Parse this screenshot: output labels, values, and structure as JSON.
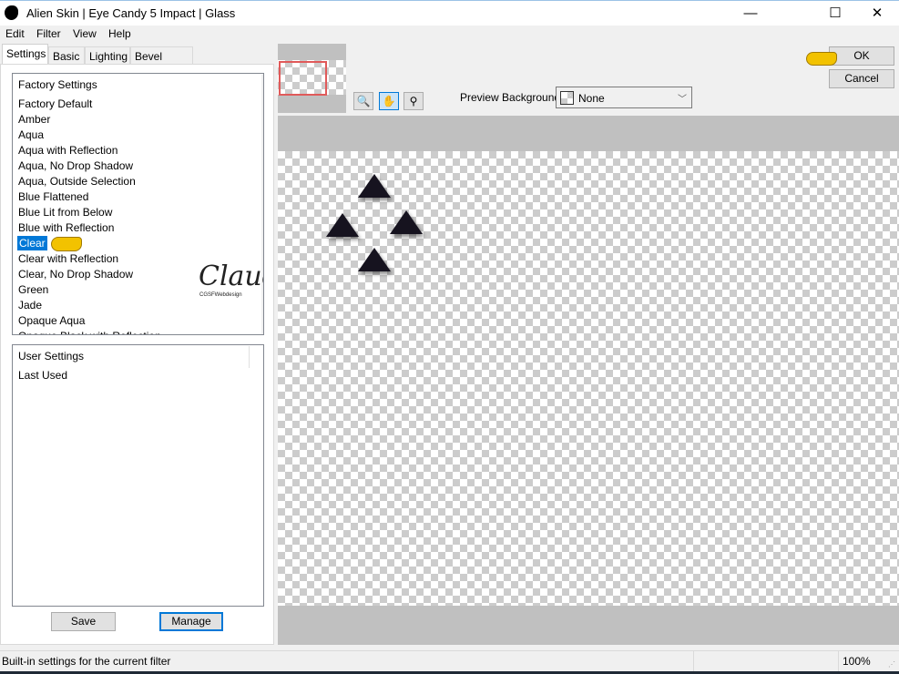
{
  "window": {
    "title": "Alien Skin | Eye Candy 5 Impact | Glass",
    "minimize": "—",
    "maximize": "☐",
    "close": "✕"
  },
  "menu": [
    "Edit",
    "Filter",
    "View",
    "Help"
  ],
  "tabs": [
    "Settings",
    "Basic",
    "Lighting",
    "Bevel Profile"
  ],
  "factory": {
    "header": "Factory Settings",
    "items": [
      "Factory Default",
      "Amber",
      "Aqua",
      "Aqua with Reflection",
      "Aqua, No Drop Shadow",
      "Aqua, Outside Selection",
      "Blue Flattened",
      "Blue Lit from Below",
      "Blue with Reflection",
      "Clear",
      "Clear with Reflection",
      "Clear, No Drop Shadow",
      "Green",
      "Jade",
      "Opaque Aqua",
      "Opaque Black with Reflection"
    ],
    "selected": "Clear"
  },
  "user": {
    "header": "User Settings",
    "items": [
      "Last Used"
    ]
  },
  "buttons": {
    "save": "Save",
    "manage": "Manage",
    "ok": "OK",
    "cancel": "Cancel"
  },
  "preview": {
    "label": "Preview Background:",
    "value": "None"
  },
  "watermark": {
    "name": "Claudia",
    "sub": "CGSFWebdesign"
  },
  "status": {
    "text": "Built-in settings for the current filter",
    "zoom": "100%"
  },
  "colors": {
    "selection": "#0078d7",
    "accent": "#0078d7"
  }
}
